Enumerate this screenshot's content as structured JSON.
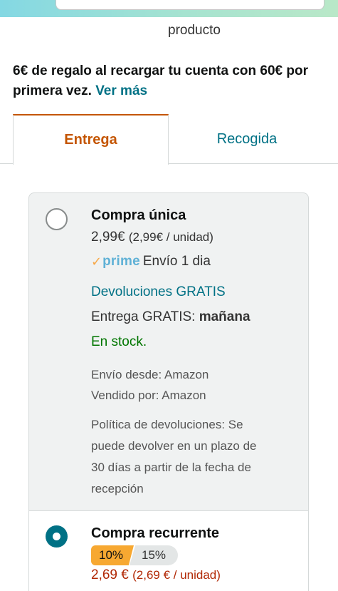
{
  "header": {
    "product_label": "producto"
  },
  "promo": {
    "text": "6€ de regalo al recargar tu cuenta con 60€ por primera vez.",
    "link": "Ver más"
  },
  "tabs": [
    {
      "label": "Entrega",
      "active": true
    },
    {
      "label": "Recogida",
      "active": false
    }
  ],
  "options": {
    "single": {
      "title": "Compra única",
      "selected": false,
      "price": "2,99€",
      "unit_price": "(2,99€ / unidad)",
      "prime_label": "prime",
      "shipping": "Envío 1 dia",
      "returns": "Devoluciones GRATIS",
      "delivery_prefix": "Entrega GRATIS:",
      "delivery_day": "mañana",
      "stock": "En stock.",
      "ships_from": "Envío desde: Amazon",
      "sold_by": "Vendido por: Amazon",
      "return_policy": [
        "Política de devoluciones: Se",
        "puede devolver en un plazo de",
        "30 días a partir de la fecha de",
        "recepción"
      ]
    },
    "recurring": {
      "title": "Compra recurrente",
      "selected": true,
      "discount_primary": "10%",
      "discount_secondary": "15%",
      "price": "2,69 €",
      "unit_price": "(2,69 € / unidad)"
    }
  },
  "colors": {
    "accent_orange": "#c45500",
    "link_teal": "#007185",
    "stock_green": "#007600",
    "price_red": "#b12704",
    "prime_blue": "#5fb1d6",
    "badge_orange": "#f7a831"
  }
}
